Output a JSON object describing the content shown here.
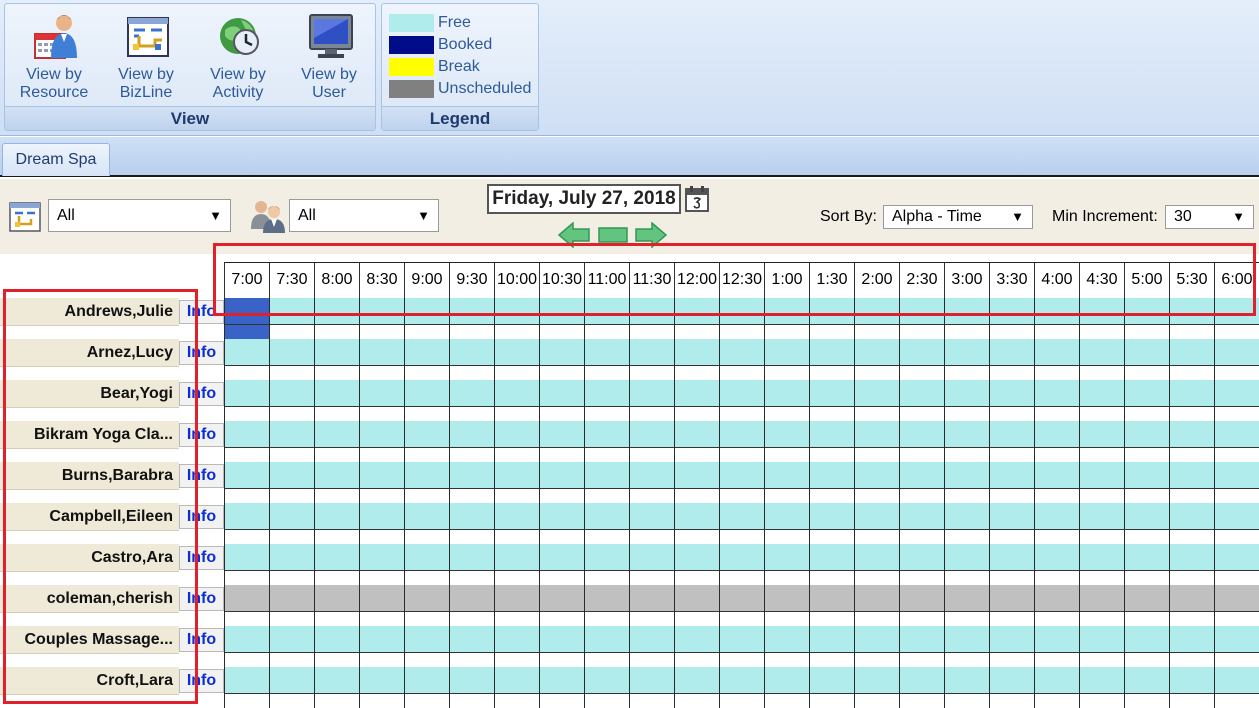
{
  "ribbon": {
    "view_group": {
      "caption": "View",
      "buttons": [
        {
          "line1": "View by",
          "line2": "Resource",
          "icon": "resource-calendar-icon"
        },
        {
          "line1": "View by",
          "line2": "BizLine",
          "icon": "bizline-chart-icon"
        },
        {
          "line1": "View by",
          "line2": "Activity",
          "icon": "activity-globe-clock-icon"
        },
        {
          "line1": "View by",
          "line2": "User",
          "icon": "user-monitor-icon"
        }
      ]
    },
    "legend_group": {
      "caption": "Legend",
      "items": [
        {
          "label": "Free",
          "color": "#b1ecec"
        },
        {
          "label": "Booked",
          "color": "#000c8a"
        },
        {
          "label": "Break",
          "color": "#ffff00"
        },
        {
          "label": "Unscheduled",
          "color": "#808080"
        }
      ]
    }
  },
  "tabs": [
    {
      "label": "Dream Spa",
      "active": true
    }
  ],
  "toolbar": {
    "bizline_filter": {
      "value": "All",
      "icon": "bizline-filter-icon"
    },
    "user_filter": {
      "value": "All",
      "icon": "user-filter-icon"
    },
    "date": "Friday, July 27, 2018",
    "date_icon": "calendar-icon",
    "nav_icons": [
      "prev-day-arrow-icon",
      "today-icon",
      "next-day-arrow-icon"
    ],
    "sort_by": {
      "label": "Sort By:",
      "value": "Alpha - Time"
    },
    "min_increment": {
      "label": "Min Increment:",
      "value": "30"
    }
  },
  "colors": {
    "free": "#b1ecec",
    "booked_slot": "#3a63c8",
    "unscheduled": "#c0c0c0",
    "highlight": "#e0202a"
  },
  "schedule": {
    "times": [
      "7:00",
      "7:30",
      "8:00",
      "8:30",
      "9:00",
      "9:30",
      "10:00",
      "10:30",
      "11:00",
      "11:30",
      "12:00",
      "12:30",
      "1:00",
      "1:30",
      "2:00",
      "2:30",
      "3:00",
      "3:30",
      "4:00",
      "4:30",
      "5:00",
      "5:30",
      "6:00"
    ],
    "info_label": "Info",
    "resources": [
      {
        "name": "Andrews,Julie",
        "status": "free",
        "booked_slots": [
          0
        ]
      },
      {
        "name": "Arnez,Lucy",
        "status": "free",
        "booked_slots": []
      },
      {
        "name": "Bear,Yogi",
        "status": "free",
        "booked_slots": []
      },
      {
        "name": "Bikram Yoga Cla...",
        "status": "free",
        "booked_slots": []
      },
      {
        "name": "Burns,Barabra",
        "status": "free",
        "booked_slots": []
      },
      {
        "name": "Campbell,Eileen",
        "status": "free",
        "booked_slots": []
      },
      {
        "name": "Castro,Ara",
        "status": "free",
        "booked_slots": []
      },
      {
        "name": "coleman,cherish",
        "status": "unscheduled",
        "booked_slots": []
      },
      {
        "name": "Couples Massage...",
        "status": "free",
        "booked_slots": []
      },
      {
        "name": "Croft,Lara",
        "status": "free",
        "booked_slots": []
      }
    ]
  }
}
